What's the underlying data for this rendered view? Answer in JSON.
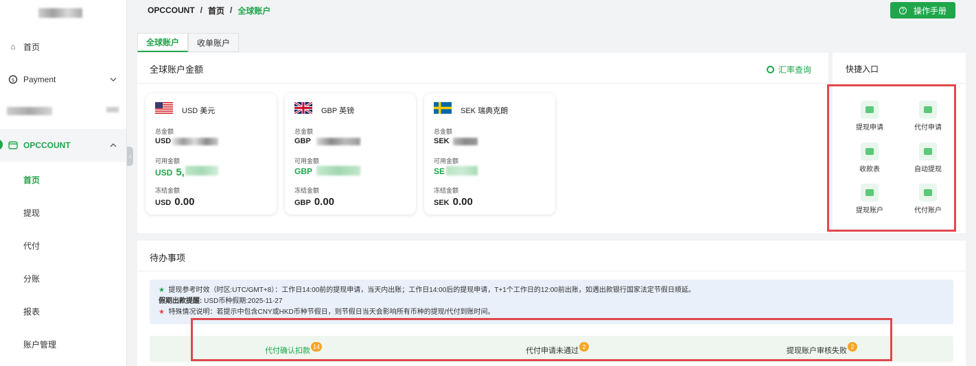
{
  "sidebar": {
    "home": "首页",
    "payment": "Payment",
    "group": "OPCCOUNT",
    "sub": [
      "首页",
      "提现",
      "代付",
      "分账",
      "报表",
      "账户管理"
    ]
  },
  "breadcrumb": {
    "root": "OPCCOUNT",
    "sep1": "/",
    "mid": "首页",
    "sep2": "/",
    "current": "全球账户"
  },
  "manual_button": "操作手册",
  "tabs": [
    "全球账户",
    "收单账户"
  ],
  "accounts": {
    "title": "全球账户金额",
    "rate_link": "汇率查询",
    "total_label": "总金额",
    "available_label": "可用金额",
    "frozen_label": "冻结金额",
    "cards": [
      {
        "currency": "USD 美元",
        "total_code": "USD",
        "avail_code": "USD",
        "avail_visible": "5,",
        "frozen_code": "USD",
        "frozen_value": "0.00"
      },
      {
        "currency": "GBP 英镑",
        "total_code": "GBP",
        "avail_code": "GBP",
        "avail_visible": "",
        "frozen_code": "GBP",
        "frozen_value": "0.00"
      },
      {
        "currency": "SEK 瑞典克朗",
        "total_code": "SEK",
        "avail_code": "SE",
        "avail_visible": "",
        "frozen_code": "SEK",
        "frozen_value": "0.00"
      }
    ]
  },
  "quick": {
    "title": "快捷入口",
    "items": [
      "提现申请",
      "代付申请",
      "收款表",
      "自动提现",
      "提现账户",
      "代付账户"
    ]
  },
  "todo": {
    "title": "待办事项",
    "notice1": "提现参考时效（时区:UTC/GMT+8）：工作日14:00前的提现申请，当天内出账；工作日14:00后的提现申请，T+1个工作日的12:00前出账，如遇出款银行国家法定节假日顺延。",
    "notice2_label": "假期出款提醒:",
    "notice2_text": " USD币种假期:2025-11-27",
    "notice3": "特殊情况说明：若提示中包含CNY或HKD币种节假日，则节假日当天会影响所有币种的提现/代付到账时间。",
    "items": [
      {
        "label": "代付确认扣款",
        "count": "14"
      },
      {
        "label": "代付申请未通过",
        "count": "2"
      },
      {
        "label": "提现账户审核失败",
        "count": "2"
      }
    ]
  },
  "colors": {
    "brand": "#1fa64a",
    "highlight": "#e0484b",
    "badge": "#f5a623"
  }
}
